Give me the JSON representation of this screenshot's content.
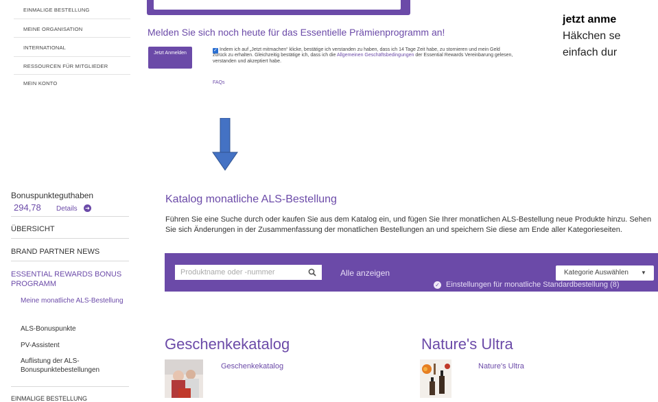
{
  "top_nav": {
    "items": [
      {
        "label": "EINMALIGE BESTELLUNG"
      },
      {
        "label": "MEINE ORGANISATION"
      },
      {
        "label": "INTERNATIONAL"
      },
      {
        "label": "RESSOURCEN FÜR MITGLIEDER"
      },
      {
        "label": "MEIN KONTO"
      }
    ]
  },
  "enroll": {
    "title": "Melden Sie sich noch heute für das Essentielle Prämienprogramm an!",
    "button_label": "Jetzt Anmelden",
    "terms_before": "Indem ich auf „Jetzt mitmachen“ klicke, bestätige ich verstanden zu haben, dass ich 14 Tage Zeit habe, zu stornieren und mein Geld zurück zu erhalten. Gleichzeitig bestätige ich, dass ich die ",
    "terms_link": "Allgemeinen Geschäftsbedingungen",
    "terms_after": " der Essential Rewards Vereinbarung gelesen, verstanden und akzeptiert habe.",
    "faq": "FAQs"
  },
  "note": {
    "bold": "jetzt anme",
    "line1": "Häkchen se",
    "line2": "einfach dur"
  },
  "sidebar": {
    "balance_label": "Bonuspunkteguthaben",
    "balance_value": "294,78",
    "details_label": "Details",
    "items": [
      {
        "label": "ÜBERSICHT"
      },
      {
        "label": "BRAND PARTNER NEWS"
      },
      {
        "label": "ESSENTIAL REWARDS BONUS PROGRAMM"
      }
    ],
    "sub_items": [
      {
        "label": "Meine monatliche ALS-Bestellung"
      },
      {
        "label": "ALS-Bonuspunkte"
      },
      {
        "label": "PV-Assistent"
      },
      {
        "label": "Auflistung der ALS-Bonuspunktebestellungen"
      }
    ],
    "bottom_item": "EINMALIGE BESTELLUNG"
  },
  "catalog": {
    "title": "Katalog monatliche ALS-Bestellung",
    "description": "Führen Sie eine Suche durch oder kaufen Sie aus dem Katalog ein, und fügen Sie Ihrer monatlichen ALS-Bestellung neue Produkte hinzu. Sehen Sie sich Änderungen in der Zusammenfassung der monatlichen Bestellungen an und speichern Sie diese am Ende aller Kategorieseiten.",
    "search_placeholder": "Produktname oder -nummer",
    "show_all": "Alle anzeigen",
    "category_select": "Kategorie Auswählen",
    "settings_link": "Einstellungen für monatliche Standardbestellung (8)",
    "categories": [
      {
        "heading": "Geschenkekatalog",
        "link": "Geschenkekatalog"
      },
      {
        "heading": "Nature's Ultra",
        "link": "Nature's Ultra"
      }
    ]
  },
  "colors": {
    "accent": "#6b4aa8",
    "arrow": "#4472c4"
  }
}
